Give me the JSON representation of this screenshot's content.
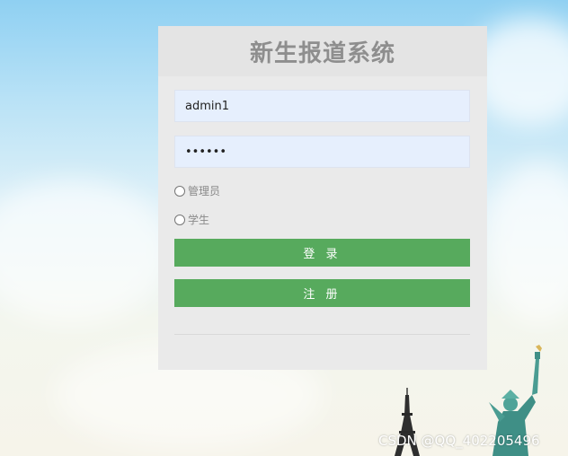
{
  "app": {
    "title": "新生报道系统"
  },
  "form": {
    "username_value": "admin1",
    "password_value": "••••••",
    "roles": [
      {
        "label": "管理员",
        "checked": false
      },
      {
        "label": "学生",
        "checked": false
      }
    ],
    "login_label": "登 录",
    "register_label": "注 册"
  },
  "watermark": "CSDN @QQ_402205496",
  "colors": {
    "button": "#57aa5d",
    "panel": "#eaeaea",
    "input_bg": "#e6effd",
    "title": "#8e8e8e"
  },
  "icons": [
    "eiffel-tower-icon",
    "statue-of-liberty-icon"
  ]
}
